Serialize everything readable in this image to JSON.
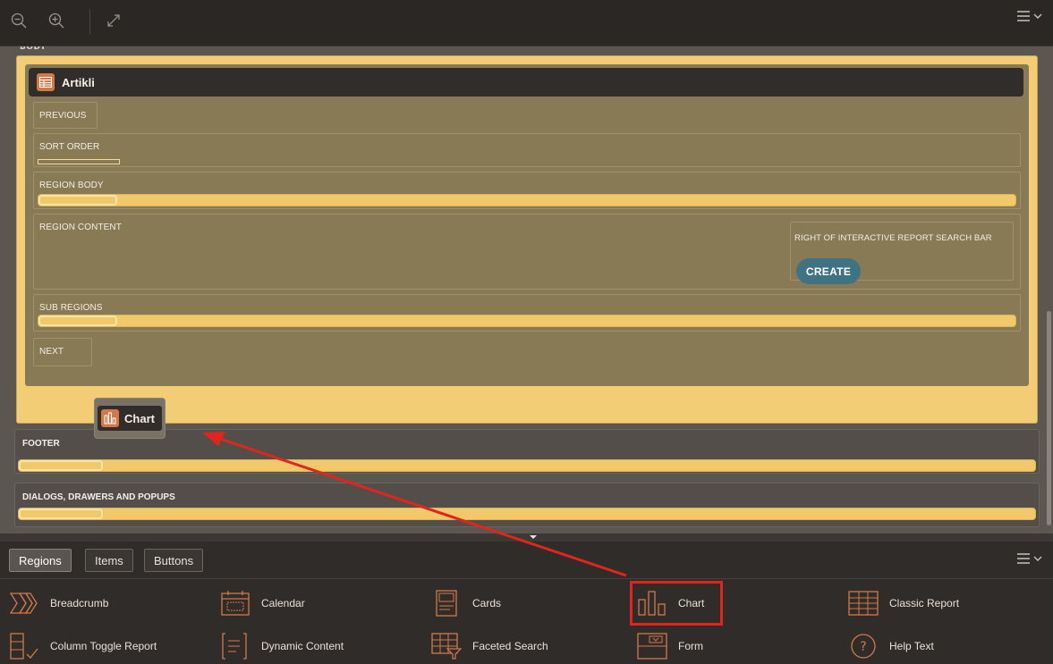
{
  "toolbar": {
    "zoom_out_icon": "zoom-out-icon",
    "zoom_in_icon": "zoom-in-icon",
    "expand_icon": "expand-icon",
    "menu_icon": "menu-icon"
  },
  "canvas": {
    "body_label": "BODY",
    "region": {
      "title": "Artikli",
      "slots": {
        "previous": "PREVIOUS",
        "sort_order": "SORT ORDER",
        "region_body": "REGION BODY",
        "region_content": "REGION CONTENT",
        "search_bar": "RIGHT OF INTERACTIVE REPORT SEARCH BAR",
        "create_button": "CREATE",
        "sub_regions": "SUB REGIONS",
        "next": "NEXT"
      }
    },
    "dragged_item": "Chart",
    "footer_label": "FOOTER",
    "dialogs_label": "DIALOGS, DRAWERS AND POPUPS"
  },
  "gallery": {
    "tabs": [
      "Regions",
      "Items",
      "Buttons"
    ],
    "active_tab": "Regions",
    "items": [
      {
        "label": "Breadcrumb",
        "icon": "breadcrumb-icon"
      },
      {
        "label": "Calendar",
        "icon": "calendar-icon"
      },
      {
        "label": "Cards",
        "icon": "cards-icon"
      },
      {
        "label": "Chart",
        "icon": "chart-icon"
      },
      {
        "label": "Classic Report",
        "icon": "classic-report-icon"
      },
      {
        "label": "Column Toggle Report",
        "icon": "column-toggle-icon"
      },
      {
        "label": "Dynamic Content",
        "icon": "dynamic-content-icon"
      },
      {
        "label": "Faceted Search",
        "icon": "faceted-search-icon"
      },
      {
        "label": "Form",
        "icon": "form-icon"
      },
      {
        "label": "Help Text",
        "icon": "help-text-icon"
      }
    ]
  },
  "colors": {
    "accent_orange": "#d07a4a",
    "drop_yellow": "#f3cc76",
    "highlight_red": "#e0261c",
    "create_blue": "#3f7384"
  }
}
